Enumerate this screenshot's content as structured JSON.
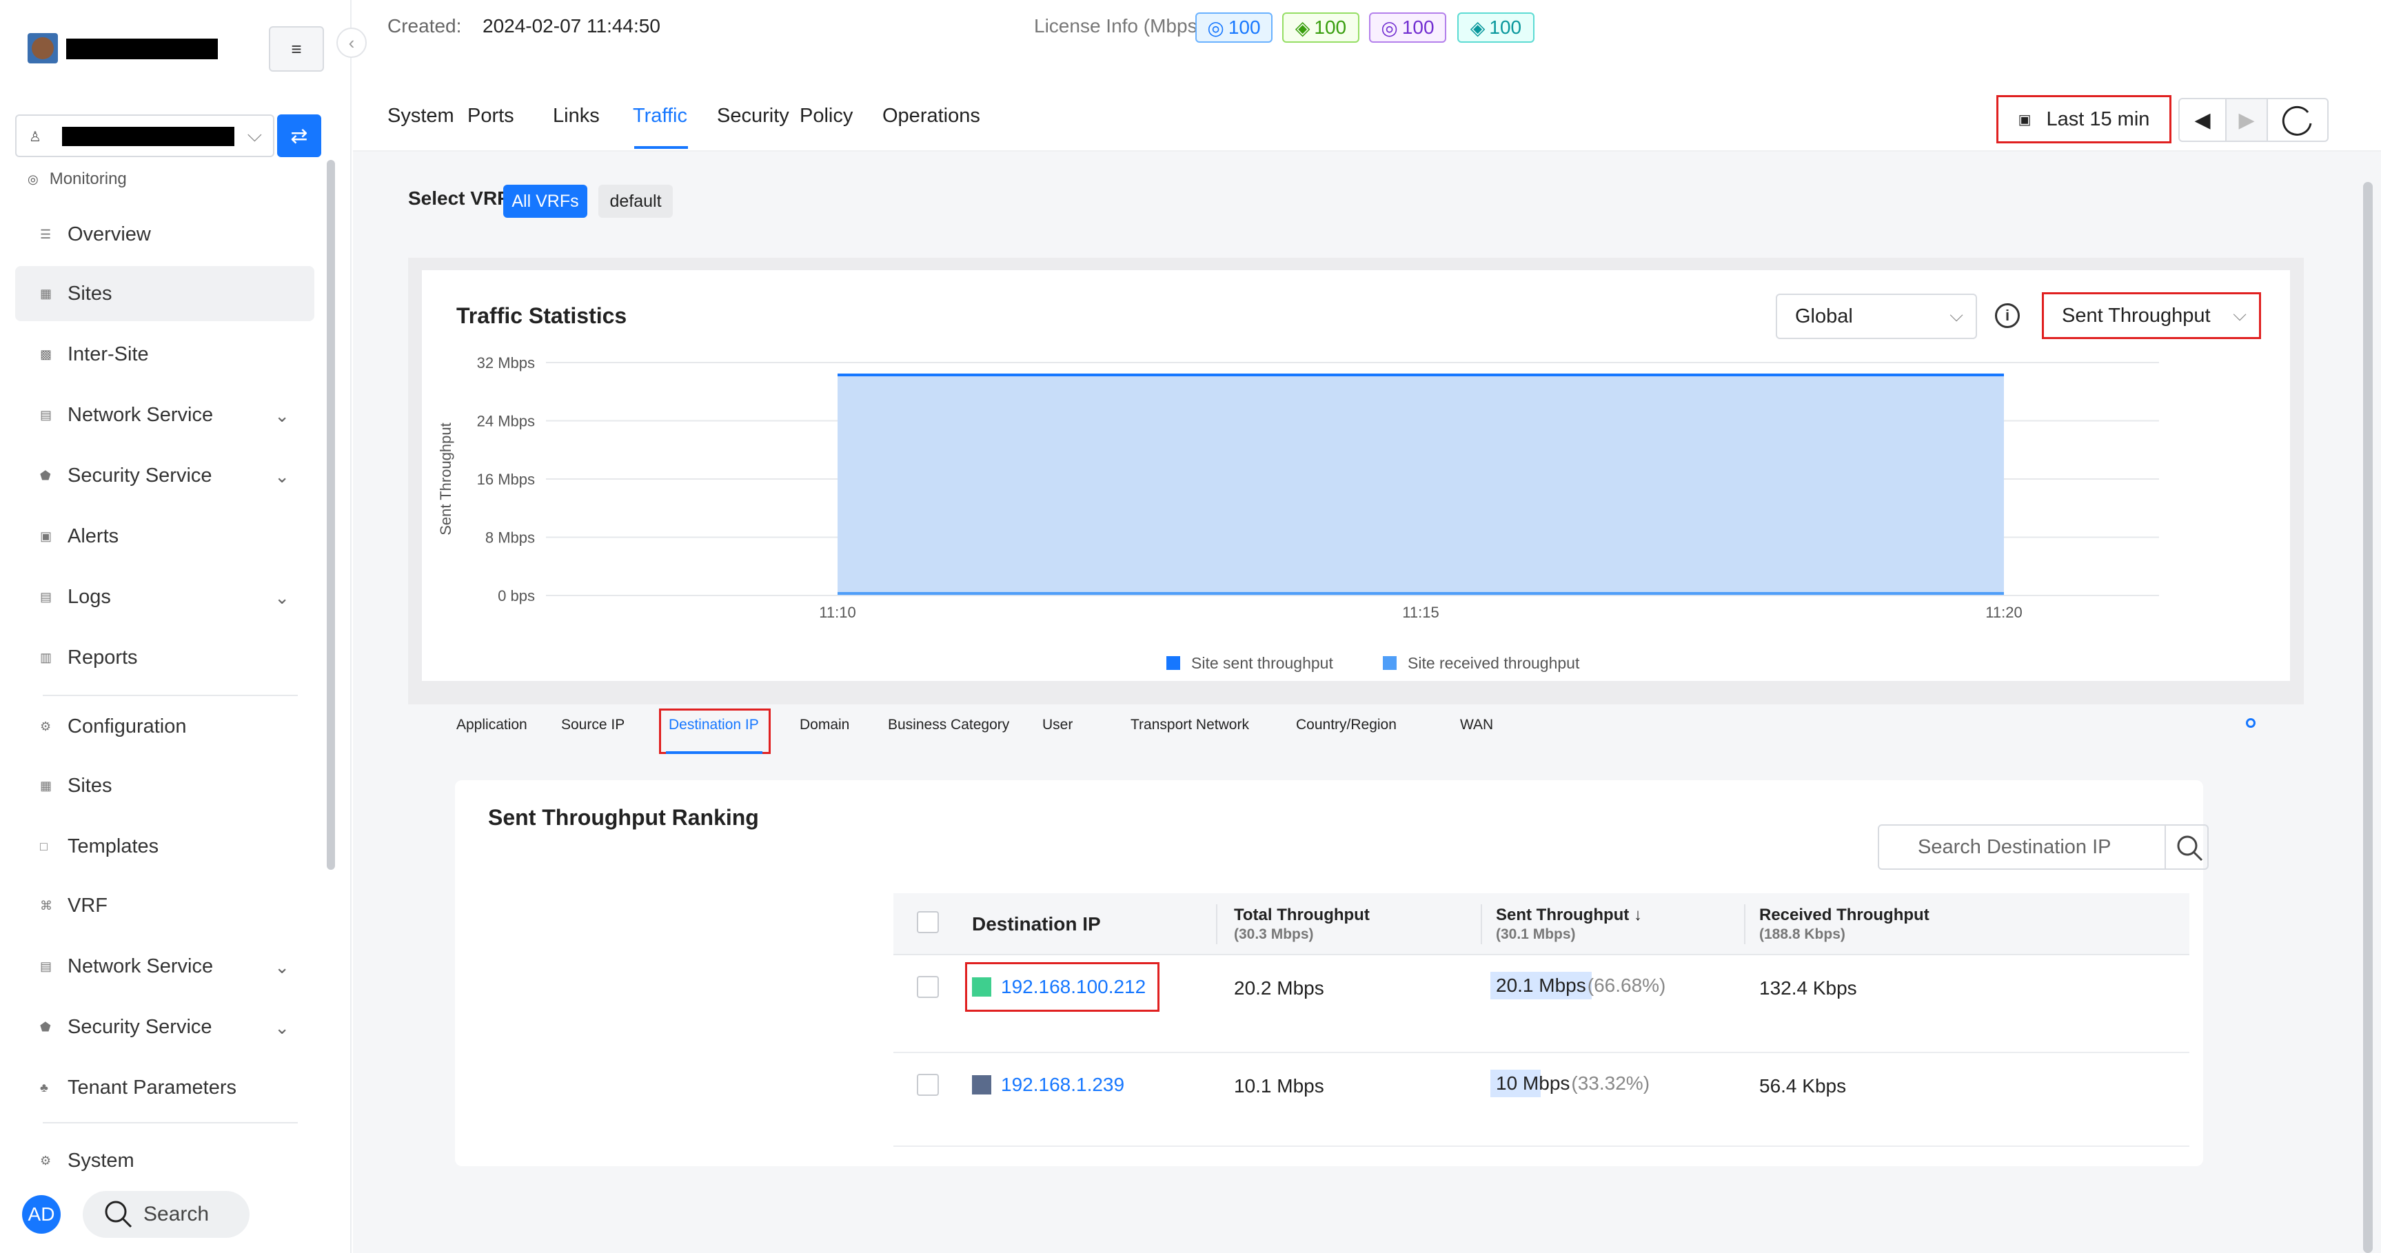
{
  "sidebar": {
    "section_monitoring": "Monitoring",
    "monitoring_items": [
      {
        "label": "Overview"
      },
      {
        "label": "Sites"
      },
      {
        "label": "Inter-Site"
      },
      {
        "label": "Network Service"
      },
      {
        "label": "Security Service"
      },
      {
        "label": "Alerts"
      },
      {
        "label": "Logs"
      },
      {
        "label": "Reports"
      }
    ],
    "config_items": [
      {
        "label": "Configuration"
      },
      {
        "label": "Sites"
      },
      {
        "label": "Templates"
      },
      {
        "label": "VRF"
      },
      {
        "label": "Network Service"
      },
      {
        "label": "Security Service"
      },
      {
        "label": "Tenant Parameters"
      }
    ],
    "system_label": "System",
    "avatar": "AD",
    "search_label": "Search"
  },
  "header": {
    "created_label": "Created:",
    "created_value": "2024-02-07 11:44:50",
    "license_label": "License Info (Mbps",
    "license_badges": [
      {
        "value": "100",
        "color": "#1677ff",
        "icon": "circle-icon"
      },
      {
        "value": "100",
        "color": "#52c41a",
        "icon": "diamond-icon"
      },
      {
        "value": "100",
        "color": "#9254de",
        "icon": "circle-icon"
      },
      {
        "value": "100",
        "color": "#13c2c2",
        "icon": "diamond-icon"
      }
    ]
  },
  "tabs": [
    "System",
    "Ports",
    "Links",
    "Traffic",
    "Security",
    "Policy",
    "Operations"
  ],
  "active_tab": "Traffic",
  "time_range": "Last 15 min",
  "vrf": {
    "label": "Select VRF",
    "options": [
      "All VRFs",
      "default"
    ],
    "selected": "All VRFs"
  },
  "traffic_stats": {
    "title": "Traffic Statistics",
    "scope": "Global",
    "metric": "Sent Throughput"
  },
  "chart_data": {
    "type": "area",
    "ylabel": "Sent Throughput",
    "yticks": [
      "0 bps",
      "8 Mbps",
      "16 Mbps",
      "24 Mbps",
      "32 Mbps"
    ],
    "ylim": [
      0,
      32
    ],
    "xticks": [
      "11:10",
      "11:15",
      "11:20"
    ],
    "x": [
      "11:10",
      "11:20"
    ],
    "series": [
      {
        "name": "Site sent throughput",
        "color": "#1677ff",
        "fill": "#c8ddf9",
        "values": [
          30.3,
          30.3
        ]
      },
      {
        "name": "Site received throughput",
        "color": "#4f9ef8",
        "values": [
          0.19,
          0.19
        ]
      }
    ],
    "grid": true,
    "legend": "bottom"
  },
  "ranking_tabs": [
    "Application",
    "Source IP",
    "Destination IP",
    "Domain",
    "Business Category",
    "User",
    "Transport Network",
    "Country/Region",
    "WAN"
  ],
  "ranking_active": "Destination IP",
  "ranking": {
    "title": "Sent Throughput Ranking",
    "search_placeholder": "Search Destination IP",
    "columns": [
      {
        "label": "Destination IP",
        "sub": ""
      },
      {
        "label": "Total Throughput",
        "sub": "(30.3 Mbps)"
      },
      {
        "label": "Sent Throughput ↓",
        "sub": "(30.1 Mbps)"
      },
      {
        "label": "Received Throughput",
        "sub": "(188.8 Kbps)"
      }
    ],
    "rows": [
      {
        "ip": "192.168.100.212",
        "color": "#3ecf8e",
        "total": "20.2 Mbps",
        "sent": "20.1 Mbps",
        "sent_pct": "(66.68%)",
        "sent_frac": 0.6668,
        "received": "132.4 Kbps"
      },
      {
        "ip": "192.168.1.239",
        "color": "#5a6b8c",
        "total": "10.1 Mbps",
        "sent": "10 Mbps",
        "sent_pct": " (33.32%)",
        "sent_frac": 0.3332,
        "received": "56.4 Kbps"
      }
    ]
  }
}
